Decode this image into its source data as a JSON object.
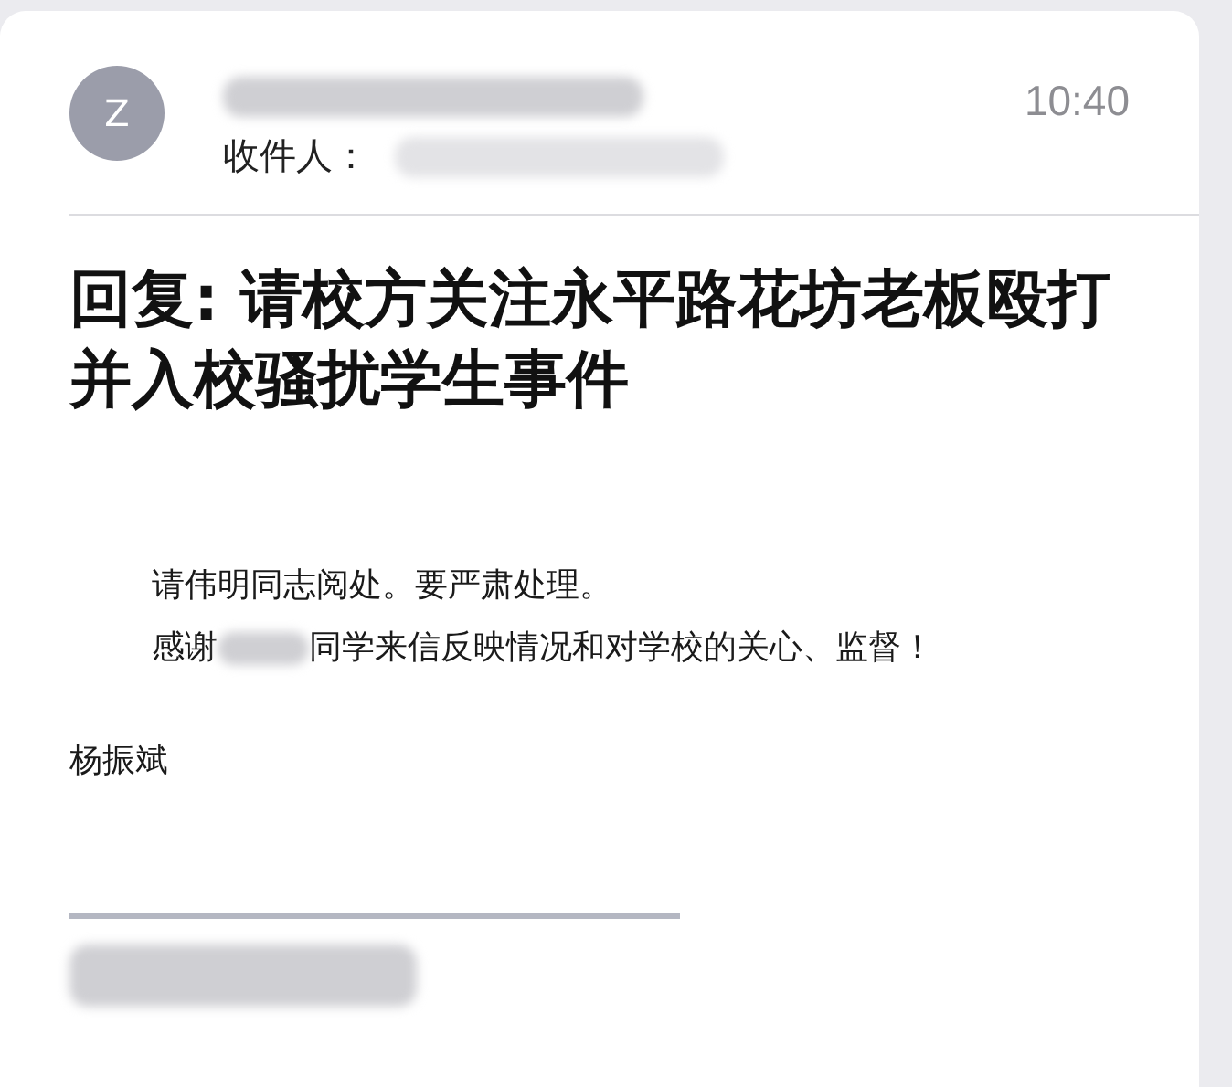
{
  "header": {
    "avatar_letter": "Z",
    "sender_redacted": true,
    "recipient_label": "收件人：",
    "recipient_redacted": true,
    "time": "10:40"
  },
  "subject": "回复: 请校方关注永平路花坊老板殴打并入校骚扰学生事件",
  "body": {
    "line_1": "请伟明同志阅处。要严肃处理。",
    "line_2_start": "感谢",
    "line_2_redacted": true,
    "line_2_end": "同学来信反映情况和对学校的关心、监督！"
  },
  "signature": "杨振斌",
  "quote_redacted": true
}
